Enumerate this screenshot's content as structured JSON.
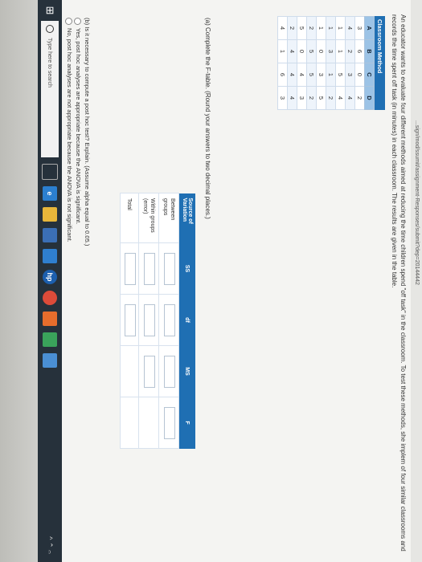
{
  "browser": {
    "url": "...sign/mod/ssumit/assignment-Responses/submit?dep=20144442"
  },
  "question": {
    "intro": "An educator wants to evaluate four different methods aimed at reducing the time children spend \"off task\" in the classroom. To test these methods, she implem of four similar classrooms and records the time spent off task (in minutes) in each classroom. The results are given in the table."
  },
  "data_table": {
    "title": "Classroom Method",
    "headers": [
      "A",
      "B",
      "C",
      "D"
    ],
    "rows": [
      [
        "3",
        "6",
        "0",
        "2"
      ],
      [
        "4",
        "2",
        "3",
        "4"
      ],
      [
        "1",
        "1",
        "5",
        "4"
      ],
      [
        "1",
        "3",
        "1",
        "2"
      ],
      [
        "1",
        "0",
        "3",
        "5"
      ],
      [
        "2",
        "5",
        "5",
        "2"
      ],
      [
        "5",
        "0",
        "4",
        "3"
      ],
      [
        "2",
        "4",
        "4",
        "4"
      ],
      [
        "4",
        "1",
        "6",
        "3"
      ]
    ]
  },
  "part_a": {
    "prompt": "(a) Complete the F-table. (Round your answers to two decimal places.)",
    "headers": [
      "Source of Variation",
      "SS",
      "df",
      "MS",
      "F"
    ],
    "rows": [
      {
        "label": "Between groups"
      },
      {
        "label": "Within groups (error)"
      },
      {
        "label": "Total"
      }
    ]
  },
  "part_b": {
    "prompt": "(b) Is it necessary to compute a post hoc test? Explain. (Assume alpha equal to 0.05.)",
    "options": [
      "Yes, post hoc analyses are appropriate because the ANOVA is significant.",
      "No, post hoc analyses are not appropriate because the ANOVA is not significant."
    ]
  },
  "taskbar": {
    "search_placeholder": "Type here to search",
    "start_glyph": "⊞",
    "tray_text": "^ ⌃ 𝄐"
  },
  "colors": {
    "accent": "#1f6fb3",
    "header_light": "#9cc3e6",
    "taskbar": "#26313b"
  }
}
